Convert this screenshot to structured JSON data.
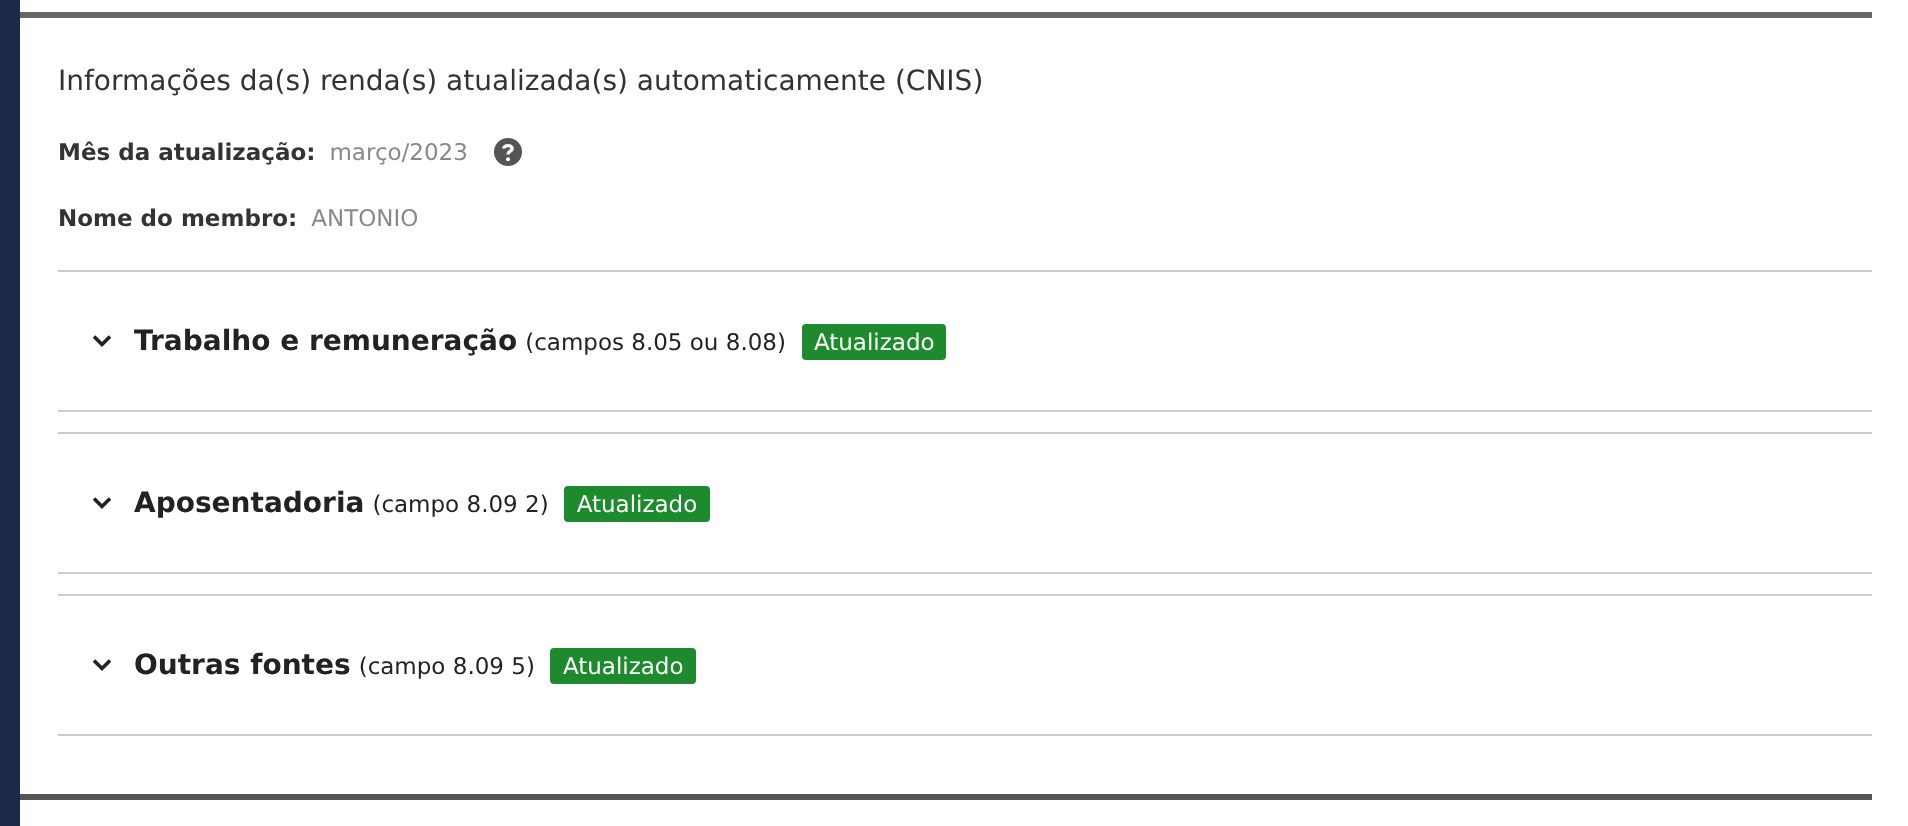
{
  "dialog": {
    "title": "Informações da(s) renda(s) atualizada(s) automaticamente (CNIS)",
    "fields": [
      {
        "label": "Mês da atualização:",
        "value": "março/2023",
        "help": true
      },
      {
        "label": "Nome do membro:",
        "value": "ANTONIO",
        "help": false
      }
    ],
    "sections": [
      {
        "title": "Trabalho e remuneração",
        "note": "(campos 8.05 ou 8.08)",
        "badge": "Atualizado",
        "expanded": false
      },
      {
        "title": "Aposentadoria",
        "note": "(campo 8.09 2)",
        "badge": "Atualizado",
        "expanded": false
      },
      {
        "title": "Outras fontes",
        "note": "(campo 8.09 5)",
        "badge": "Atualizado",
        "expanded": false
      }
    ]
  }
}
